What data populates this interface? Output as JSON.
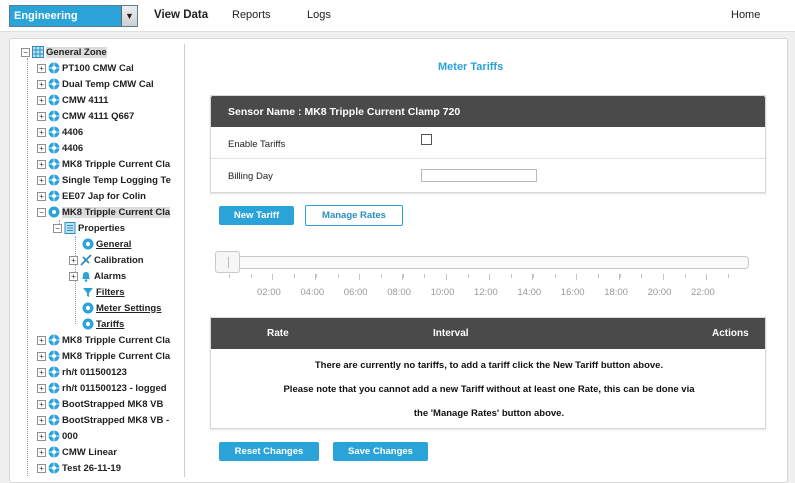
{
  "topbar": {
    "department": "Engineering",
    "nav": [
      "View Data",
      "Reports",
      "Logs"
    ],
    "home": "Home"
  },
  "tree": {
    "root": "General Zone",
    "items_before": [
      "PT100 CMW Cal",
      "Dual Temp CMW Cal",
      "CMW 4111",
      "CMW 4111 Q667",
      "4406",
      "4406",
      "MK8 Tripple Current Cla",
      "Single Temp Logging Te",
      "EE07 Jap for Colin"
    ],
    "selected_sensor": "MK8 Tripple Current Cla",
    "properties": "Properties",
    "sub": {
      "general": "General",
      "calibration": "Calibration",
      "alarms": "Alarms",
      "filters": "Filters",
      "meter_settings": "Meter Settings",
      "tariffs": "Tariffs"
    },
    "items_after": [
      "MK8 Tripple Current Cla",
      "MK8 Tripple Current Cla",
      "rh/t 011500123",
      "rh/t 011500123 - logged",
      "BootStrapped MK8 VB",
      "BootStrapped MK8 VB -",
      "000",
      "CMW Linear",
      "Test 26-11-19"
    ]
  },
  "content": {
    "title": "Meter Tariffs",
    "sensor_header": "Sensor Name : MK8 Tripple Current Clamp 720",
    "enable_tariffs_label": "Enable Tariffs",
    "enable_tariffs_checked": false,
    "billing_day_label": "Billing Day",
    "billing_day_value": "",
    "new_tariff": "New Tariff",
    "manage_rates": "Manage Rates",
    "timeline": [
      "02:00",
      "04:00",
      "06:00",
      "08:00",
      "10:00",
      "12:00",
      "14:00",
      "16:00",
      "18:00",
      "20:00",
      "22:00"
    ],
    "table_headers": {
      "rate": "Rate",
      "interval": "Interval",
      "actions": "Actions"
    },
    "messages": [
      "There are currently no tariffs, to add a tariff click the New Tariff button above.",
      "Please note that you cannot add a new Tariff without at least one Rate, this can be done via",
      "the 'Manage Rates' button above."
    ],
    "reset_changes": "Reset Changes",
    "save_changes": "Save Changes"
  }
}
